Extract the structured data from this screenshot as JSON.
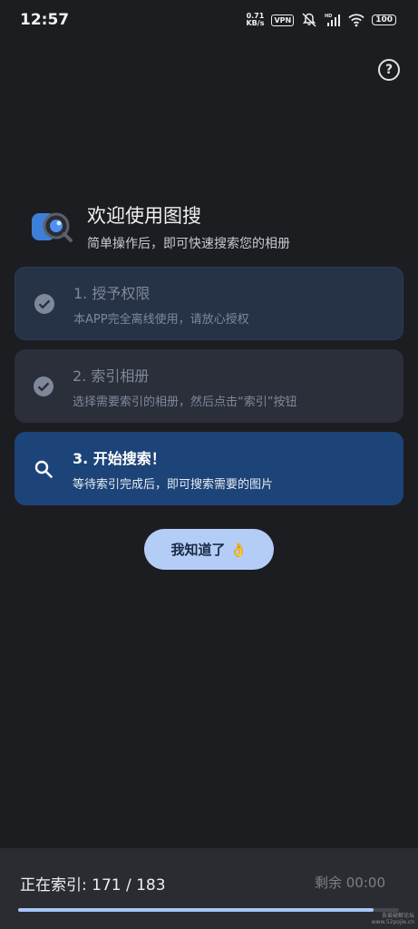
{
  "statusbar": {
    "time": "12:57",
    "net_speed_value": "0.71",
    "net_speed_unit": "KB/s",
    "vpn": "VPN",
    "battery": "100"
  },
  "header": {
    "title": "欢迎使用图搜",
    "subtitle": "简单操作后，即可快速搜索您的相册"
  },
  "steps": [
    {
      "title": "1. 授予权限",
      "desc": "本APP完全离线使用，请放心授权",
      "state": "done"
    },
    {
      "title": "2. 索引相册",
      "desc": "选择需要索引的相册，然后点击“索引”按钮",
      "state": "done"
    },
    {
      "title": "3. 开始搜索！",
      "desc": "等待索引完成后，即可搜索需要的图片",
      "state": "active"
    }
  ],
  "ok_button": {
    "label": "我知道了 👌"
  },
  "progress": {
    "status_text": "正在索引: 171 / 183",
    "remaining_text": "剩余 00:00",
    "current": 171,
    "total": 183
  },
  "watermark": {
    "line1": "吾爱破解论坛",
    "line2": "www.52pojie.cn"
  },
  "colors": {
    "background": "#1c1d21",
    "active_card": "#1d4478",
    "button": "#b3cdf7",
    "progress_fill": "#a8c6f8"
  }
}
